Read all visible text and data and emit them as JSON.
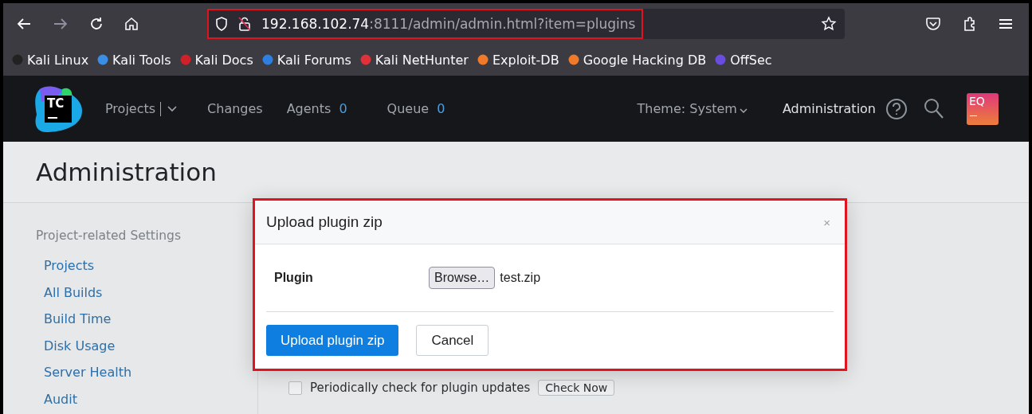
{
  "browser": {
    "url_host": "192.168.102.74",
    "url_rest": ":8111/admin/admin.html?item=plugins",
    "bookmarks": [
      {
        "label": "Kali Linux",
        "color": "#222222"
      },
      {
        "label": "Kali Tools",
        "color": "#3a8ee6"
      },
      {
        "label": "Kali Docs",
        "color": "#d0202a"
      },
      {
        "label": "Kali Forums",
        "color": "#2f7fe0"
      },
      {
        "label": "Kali NetHunter",
        "color": "#e0303a"
      },
      {
        "label": "Exploit-DB",
        "color": "#f07a2a"
      },
      {
        "label": "Google Hacking DB",
        "color": "#f07a2a"
      },
      {
        "label": "OffSec",
        "color": "#6a4ce0"
      }
    ]
  },
  "header": {
    "logo": "TC",
    "nav": [
      {
        "label": "Projects"
      },
      {
        "label": "Changes"
      },
      {
        "label": "Agents",
        "count": "0"
      },
      {
        "label": "Queue",
        "count": "0"
      }
    ],
    "theme": "Theme: System",
    "admin": "Administration",
    "avatar": "EQ"
  },
  "page_title": "Administration",
  "sidebar": {
    "heading": "Project-related Settings",
    "items": [
      "Projects",
      "All Builds",
      "Build Time",
      "Disk Usage",
      "Server Health",
      "Audit"
    ]
  },
  "settings_row": {
    "checked": false,
    "label": "Periodically check for plugin updates",
    "button": "Check Now"
  },
  "modal": {
    "title": "Upload plugin zip",
    "close": "×",
    "field_label": "Plugin",
    "browse": "Browse…",
    "filename": "test.zip",
    "buttons": [
      {
        "label": "Upload plugin zip",
        "kind": "primary"
      },
      {
        "label": "Cancel",
        "kind": "secondary"
      }
    ]
  }
}
